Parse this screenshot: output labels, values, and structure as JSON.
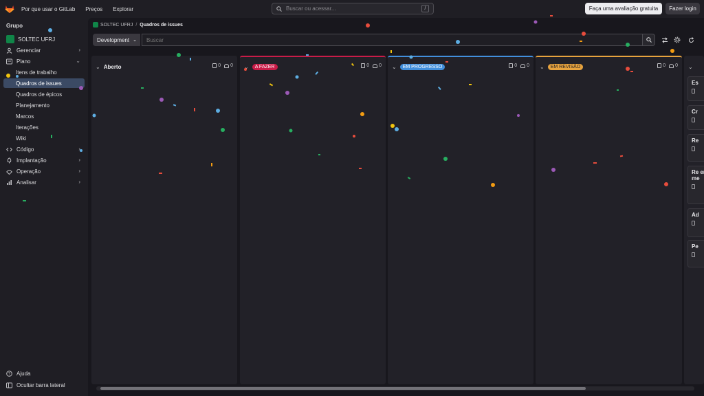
{
  "topbar": {
    "links": [
      "Por que usar o GitLab",
      "Preços",
      "Explorar"
    ],
    "search_placeholder": "Buscar ou acessar...",
    "search_shortcut": "/",
    "trial_label": "Faça uma avaliação gratuita",
    "login_label": "Fazer login"
  },
  "sidebar": {
    "section": "Grupo",
    "group_name": "SOLTEC UFRJ",
    "items": [
      {
        "label": "Gerenciar",
        "icon": "manage-icon"
      },
      {
        "label": "Plano",
        "icon": "plan-icon"
      },
      {
        "label": "Itens de trabalho"
      },
      {
        "label": "Quadros de issues"
      },
      {
        "label": "Quadros de épicos"
      },
      {
        "label": "Planejamento"
      },
      {
        "label": "Marcos"
      },
      {
        "label": "Iterações"
      },
      {
        "label": "Wiki"
      },
      {
        "label": "Código",
        "icon": "code-icon"
      },
      {
        "label": "Implantação",
        "icon": "deploy-icon"
      },
      {
        "label": "Operação",
        "icon": "operate-icon"
      },
      {
        "label": "Analisar",
        "icon": "analyze-icon"
      }
    ],
    "help_label": "Ajuda",
    "hide_label": "Ocultar barra lateral"
  },
  "breadcrumb": {
    "group": "SOLTEC UFRJ",
    "current": "Quadros de issues"
  },
  "filter": {
    "board_name": "Development",
    "placeholder": "Buscar"
  },
  "columns": [
    {
      "title": "Aberto",
      "issues": "0",
      "weight": "0",
      "label_color": ""
    },
    {
      "title": "A FAZER",
      "issues": "0",
      "weight": "0",
      "label_color": "#c91c48"
    },
    {
      "title": "EM PROGRESSO",
      "issues": "0",
      "weight": "0",
      "label_color": "#428fdc"
    },
    {
      "title": "EM REVISÃO",
      "issues": "0",
      "weight": "0",
      "label_color": "#e7a33e"
    }
  ],
  "last_column_cards": [
    "Es",
    "Cr",
    "Re",
    "Re en me",
    "Ad",
    "Pe"
  ]
}
